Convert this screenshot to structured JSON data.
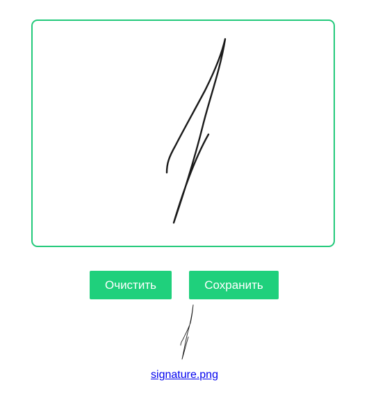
{
  "buttons": {
    "clear_label": "Очистить",
    "save_label": "Сохранить"
  },
  "download": {
    "filename": "signature.png"
  },
  "colors": {
    "accent": "#1fd07c",
    "border": "#22c97a",
    "ink": "#1a1a1a",
    "link": "#0000ee"
  }
}
